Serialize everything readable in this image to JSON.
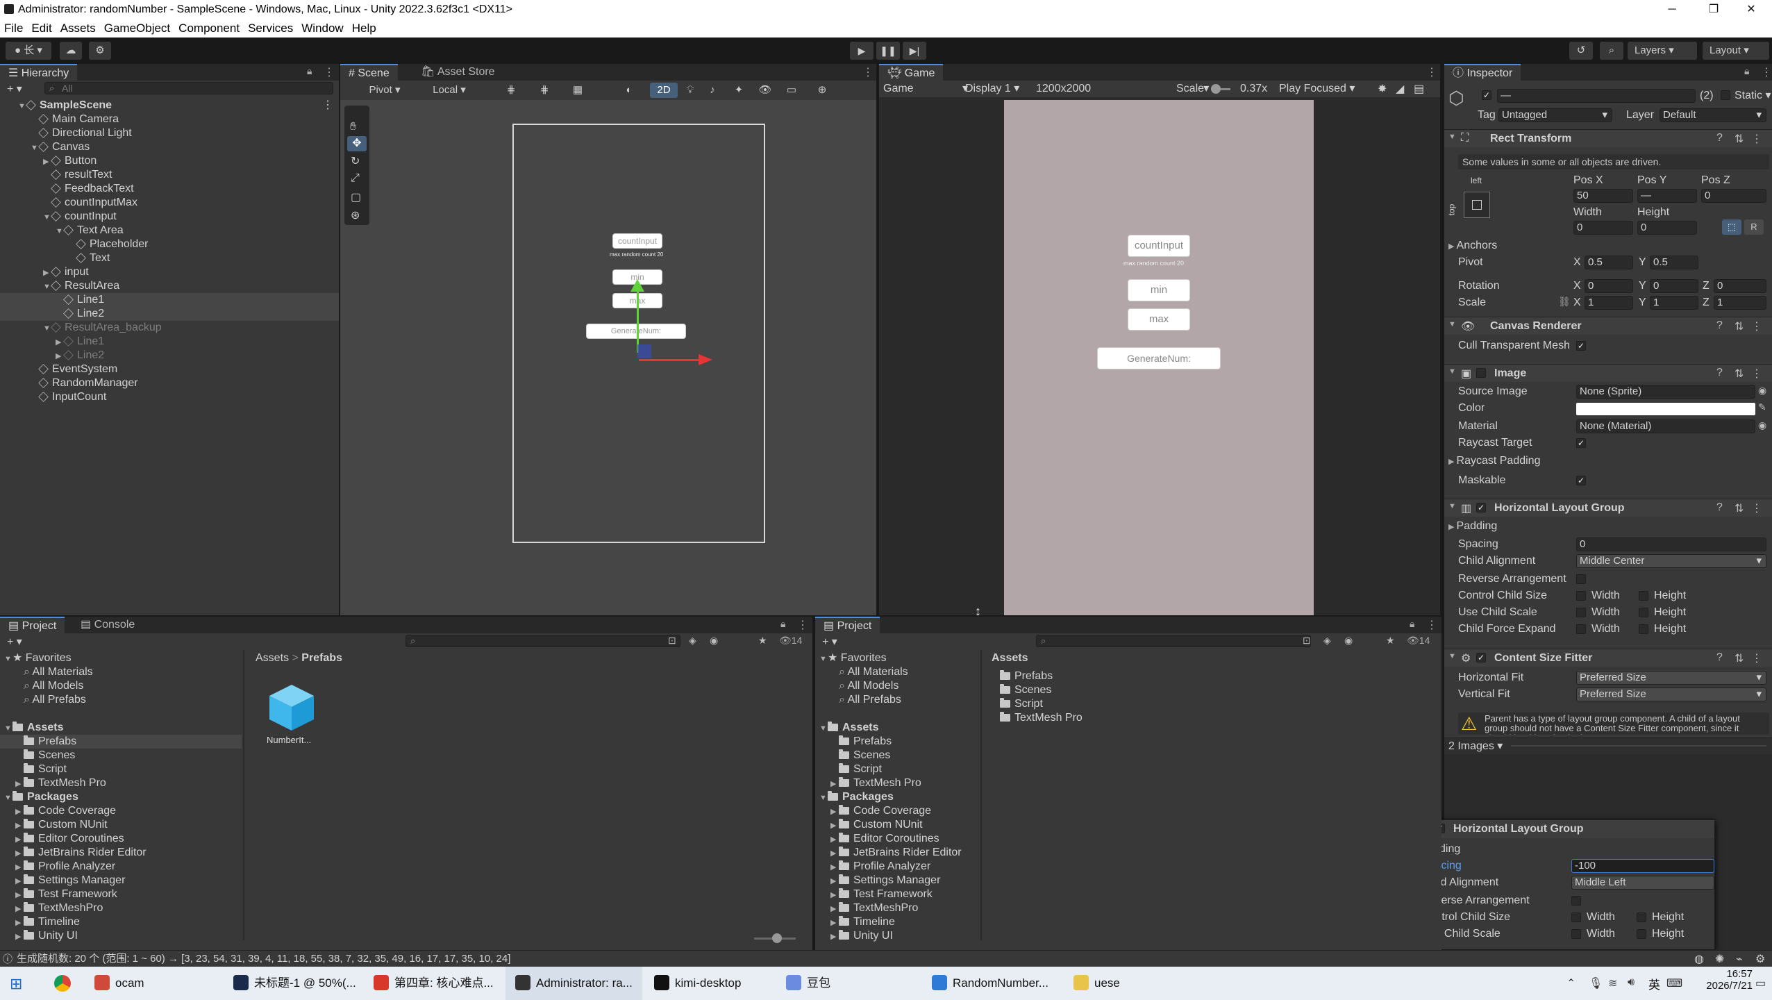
{
  "window": {
    "title": "Administrator: randomNumber - SampleScene - Windows, Mac, Linux - Unity 2022.3.62f3c1 <DX11>"
  },
  "menu": [
    "File",
    "Edit",
    "Assets",
    "GameObject",
    "Component",
    "Services",
    "Window",
    "Help"
  ],
  "toolbar": {
    "account": "长",
    "layers": "Layers",
    "layout": "Layout"
  },
  "hierarchy": {
    "tab": "Hierarchy",
    "search_placeholder": "All",
    "items": [
      {
        "label": "SampleScene",
        "indent": 0,
        "bold": true,
        "arrow": "▼"
      },
      {
        "label": "Main Camera",
        "indent": 1
      },
      {
        "label": "Directional Light",
        "indent": 1
      },
      {
        "label": "Canvas",
        "indent": 1,
        "arrow": "▼"
      },
      {
        "label": "Button",
        "indent": 2,
        "arrow": "▶"
      },
      {
        "label": "resultText",
        "indent": 2
      },
      {
        "label": "FeedbackText",
        "indent": 2
      },
      {
        "label": "countInputMax",
        "indent": 2
      },
      {
        "label": "countInput",
        "indent": 2,
        "arrow": "▼"
      },
      {
        "label": "Text Area",
        "indent": 3,
        "arrow": "▼"
      },
      {
        "label": "Placeholder",
        "indent": 4
      },
      {
        "label": "Text",
        "indent": 4
      },
      {
        "label": "input",
        "indent": 2,
        "arrow": "▶"
      },
      {
        "label": "ResultArea",
        "indent": 2,
        "arrow": "▼"
      },
      {
        "label": "Line1",
        "indent": 3,
        "selected": true
      },
      {
        "label": "Line2",
        "indent": 3,
        "selected": true
      },
      {
        "label": "ResultArea_backup",
        "indent": 2,
        "arrow": "▼",
        "dim": true
      },
      {
        "label": "Line1",
        "indent": 3,
        "arrow": "▶",
        "dim": true
      },
      {
        "label": "Line2",
        "indent": 3,
        "arrow": "▶",
        "dim": true
      },
      {
        "label": "EventSystem",
        "indent": 1
      },
      {
        "label": "RandomManager",
        "indent": 1
      },
      {
        "label": "InputCount",
        "indent": 1
      }
    ]
  },
  "scene": {
    "tabs": [
      "Scene",
      "Asset Store"
    ],
    "pivot": "Pivot",
    "local": "Local",
    "mode2d": "2D",
    "labels": {
      "countInput": "countInput",
      "hint": "max random count 20",
      "min": "min",
      "max": "max",
      "generate": "GenerateNum:"
    }
  },
  "game": {
    "tab": "Game",
    "display_mode": "Game",
    "display": "Display 1",
    "resolution": "1200x2000",
    "scale_label": "Scale",
    "scale_value": "0.37x",
    "play_focused": "Play Focused",
    "labels": {
      "countInput": "countInput",
      "hint": "max random count 20",
      "min": "min",
      "max": "max",
      "generate": "GenerateNum:"
    }
  },
  "inspector": {
    "tab": "Inspector",
    "name_value": "—",
    "count": "(2)",
    "static_label": "Static",
    "tag_label": "Tag",
    "tag_value": "Untagged",
    "layer_label": "Layer",
    "layer_value": "Default",
    "rect": {
      "title": "Rect Transform",
      "note": "Some values in some or all objects are driven.",
      "anchor_h": "left",
      "anchor_v": "top",
      "posx_label": "Pos X",
      "posy_label": "Pos Y",
      "posz_label": "Pos Z",
      "posx": "50",
      "posy": "—",
      "posz": "0",
      "width_label": "Width",
      "height_label": "Height",
      "width": "0",
      "height": "0",
      "anchors": "Anchors",
      "pivot": "Pivot",
      "pivot_x": "0.5",
      "pivot_y": "0.5",
      "rotation": "Rotation",
      "rot_x": "0",
      "rot_y": "0",
      "rot_z": "0",
      "scale": "Scale",
      "scale_x": "1",
      "scale_y": "1",
      "scale_z": "1"
    },
    "canvas_renderer": {
      "title": "Canvas Renderer",
      "cull": "Cull Transparent Mesh"
    },
    "image": {
      "title": "Image",
      "source_label": "Source Image",
      "source_value": "None (Sprite)",
      "color_label": "Color",
      "material_label": "Material",
      "material_value": "None (Material)",
      "raycast_target": "Raycast Target",
      "raycast_padding": "Raycast Padding",
      "maskable": "Maskable"
    },
    "hlg": {
      "title": "Horizontal Layout Group",
      "padding": "Padding",
      "spacing_label": "Spacing",
      "spacing_value": "0",
      "child_alignment_label": "Child Alignment",
      "child_alignment_value": "Middle Center",
      "reverse": "Reverse Arrangement",
      "control_size": "Control Child Size",
      "use_scale": "Use Child Scale",
      "force_expand": "Child Force Expand",
      "width": "Width",
      "height": "Height"
    },
    "csf": {
      "title": "Content Size Fitter",
      "hfit_label": "Horizontal Fit",
      "hfit_value": "Preferred Size",
      "vfit_label": "Vertical Fit",
      "vfit_value": "Preferred Size",
      "warning": "Parent has a type of layout group component. A child of a layout group should not have a Content Size Fitter component, since it should be driven by the layout group."
    },
    "preview": "2 Images"
  },
  "popup": {
    "title": "Horizontal Layout Group",
    "padding": "Padding",
    "spacing_label": "Spacing",
    "spacing_value": "-100",
    "child_alignment_label": "Child Alignment",
    "child_alignment_value": "Middle Left",
    "reverse": "Reverse Arrangement",
    "control_size": "Control Child Size",
    "use_scale": "Use Child Scale",
    "width": "Width",
    "height": "Height"
  },
  "project_left": {
    "tabs": [
      "Project",
      "Console"
    ],
    "count": "14",
    "breadcrumb": [
      "Assets",
      "Prefabs"
    ],
    "tree": [
      {
        "label": "Favorites",
        "indent": 0,
        "arrow": "▼",
        "star": true
      },
      {
        "label": "All Materials",
        "indent": 1,
        "search": true
      },
      {
        "label": "All Models",
        "indent": 1,
        "search": true
      },
      {
        "label": "All Prefabs",
        "indent": 1,
        "search": true
      },
      {
        "label": "",
        "indent": 0,
        "spacer": true
      },
      {
        "label": "Assets",
        "indent": 0,
        "arrow": "▼",
        "bold": true
      },
      {
        "label": "Prefabs",
        "indent": 1,
        "selected": true
      },
      {
        "label": "Scenes",
        "indent": 1
      },
      {
        "label": "Script",
        "indent": 1
      },
      {
        "label": "TextMesh Pro",
        "indent": 1,
        "arrow": "▶"
      },
      {
        "label": "Packages",
        "indent": 0,
        "arrow": "▼",
        "bold": true
      },
      {
        "label": "Code Coverage",
        "indent": 1,
        "arrow": "▶"
      },
      {
        "label": "Custom NUnit",
        "indent": 1,
        "arrow": "▶"
      },
      {
        "label": "Editor Coroutines",
        "indent": 1,
        "arrow": "▶"
      },
      {
        "label": "JetBrains Rider Editor",
        "indent": 1,
        "arrow": "▶"
      },
      {
        "label": "Profile Analyzer",
        "indent": 1,
        "arrow": "▶"
      },
      {
        "label": "Settings Manager",
        "indent": 1,
        "arrow": "▶"
      },
      {
        "label": "Test Framework",
        "indent": 1,
        "arrow": "▶"
      },
      {
        "label": "TextMeshPro",
        "indent": 1,
        "arrow": "▶"
      },
      {
        "label": "Timeline",
        "indent": 1,
        "arrow": "▶"
      },
      {
        "label": "Unity UI",
        "indent": 1,
        "arrow": "▶"
      }
    ],
    "asset": "NumberIt..."
  },
  "project_right": {
    "tab": "Project",
    "count": "14",
    "header": "Assets",
    "tree": [
      {
        "label": "Favorites",
        "indent": 0,
        "arrow": "▼",
        "star": true
      },
      {
        "label": "All Materials",
        "indent": 1,
        "search": true
      },
      {
        "label": "All Models",
        "indent": 1,
        "search": true
      },
      {
        "label": "All Prefabs",
        "indent": 1,
        "search": true
      },
      {
        "label": "",
        "indent": 0,
        "spacer": true
      },
      {
        "label": "Assets",
        "indent": 0,
        "arrow": "▼",
        "bold": true
      },
      {
        "label": "Prefabs",
        "indent": 1
      },
      {
        "label": "Scenes",
        "indent": 1
      },
      {
        "label": "Script",
        "indent": 1
      },
      {
        "label": "TextMesh Pro",
        "indent": 1,
        "arrow": "▶"
      },
      {
        "label": "Packages",
        "indent": 0,
        "arrow": "▼",
        "bold": true
      },
      {
        "label": "Code Coverage",
        "indent": 1,
        "arrow": "▶"
      },
      {
        "label": "Custom NUnit",
        "indent": 1,
        "arrow": "▶"
      },
      {
        "label": "Editor Coroutines",
        "indent": 1,
        "arrow": "▶"
      },
      {
        "label": "JetBrains Rider Editor",
        "indent": 1,
        "arrow": "▶"
      },
      {
        "label": "Profile Analyzer",
        "indent": 1,
        "arrow": "▶"
      },
      {
        "label": "Settings Manager",
        "indent": 1,
        "arrow": "▶"
      },
      {
        "label": "Test Framework",
        "indent": 1,
        "arrow": "▶"
      },
      {
        "label": "TextMeshPro",
        "indent": 1,
        "arrow": "▶"
      },
      {
        "label": "Timeline",
        "indent": 1,
        "arrow": "▶"
      },
      {
        "label": "Unity UI",
        "indent": 1,
        "arrow": "▶"
      }
    ],
    "files": [
      "Prefabs",
      "Scenes",
      "Script",
      "TextMesh Pro"
    ]
  },
  "status": "生成随机数: 20 个 (范围: 1 ~ 60) → [3, 23, 54, 31, 39, 4, 11, 18, 55, 38, 7, 32, 35, 49, 16, 17, 17, 35, 10, 24]",
  "taskbar": {
    "items": [
      {
        "label": "ocam",
        "color": "#d04a3c"
      },
      {
        "label": "未标题-1 @ 50%(...",
        "color": "#1b2a4a"
      },
      {
        "label": "第四章: 核心难点...",
        "color": "#d8382a"
      },
      {
        "label": "Administrator: ra...",
        "color": "#333333"
      },
      {
        "label": "kimi-desktop",
        "color": "#111111"
      },
      {
        "label": "豆包",
        "color": "#6b8be0"
      },
      {
        "label": "RandomNumber...",
        "color": "#2f7ad6"
      },
      {
        "label": "uese",
        "color": "#e8c44a"
      }
    ],
    "ime": "英",
    "time": "16:57",
    "date": "2026/7/21"
  }
}
